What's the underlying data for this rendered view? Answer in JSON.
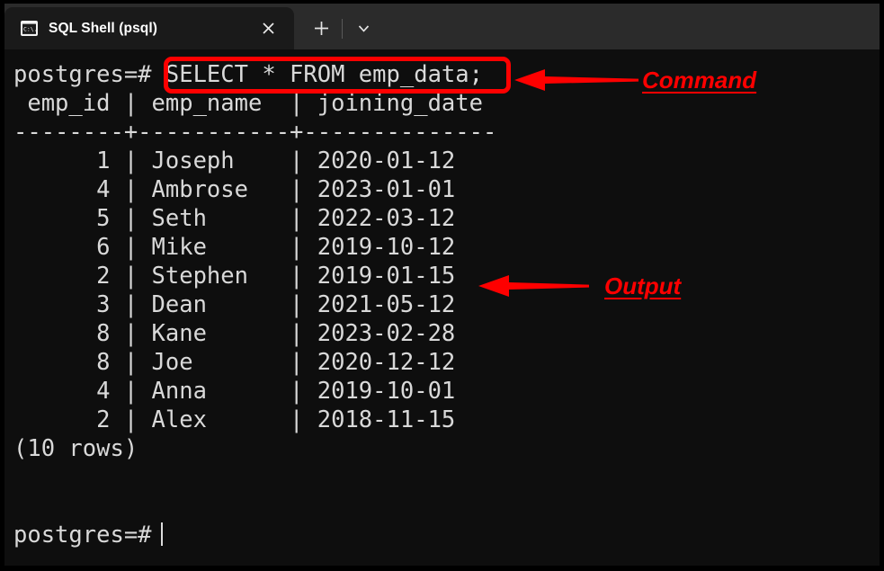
{
  "window": {
    "title": "SQL Shell (psql)",
    "background_color": "#0e0e0e",
    "tabstrip_color": "#2b2b2b",
    "text_color": "#d9d9d9",
    "accent_color": "#fe0000"
  },
  "tabstrip": {
    "tab_label": "SQL Shell (psql)",
    "icon_name": "console-icon",
    "close_label": "✕",
    "new_tab_label": "+",
    "dropdown_label": "⌄"
  },
  "terminal": {
    "prompt": "postgres=#",
    "command": "SELECT * FROM emp_data;",
    "command_line": "postgres=# SELECT * FROM emp_data;",
    "header_line": " emp_id | emp_name  | joining_date",
    "separator_line": "--------+-----------+--------------",
    "rows": [
      "      1 | Joseph    | 2020-01-12",
      "      4 | Ambrose   | 2023-01-01",
      "      5 | Seth      | 2022-03-12",
      "      6 | Mike      | 2019-10-12",
      "      2 | Stephen   | 2019-01-15",
      "      3 | Dean      | 2021-05-12",
      "      8 | Kane      | 2023-02-28",
      "      8 | Joe       | 2020-12-12",
      "      4 | Anna      | 2019-10-01",
      "      2 | Alex      | 2018-11-15"
    ],
    "row_count_line": "(10 rows)",
    "final_prompt": "postgres=#",
    "columns": [
      "emp_id",
      "emp_name",
      "joining_date"
    ],
    "table_data": [
      {
        "emp_id": "1",
        "emp_name": "Joseph",
        "joining_date": "2020-01-12"
      },
      {
        "emp_id": "4",
        "emp_name": "Ambrose",
        "joining_date": "2023-01-01"
      },
      {
        "emp_id": "5",
        "emp_name": "Seth",
        "joining_date": "2022-03-12"
      },
      {
        "emp_id": "6",
        "emp_name": "Mike",
        "joining_date": "2019-10-12"
      },
      {
        "emp_id": "2",
        "emp_name": "Stephen",
        "joining_date": "2019-01-15"
      },
      {
        "emp_id": "3",
        "emp_name": "Dean",
        "joining_date": "2021-05-12"
      },
      {
        "emp_id": "8",
        "emp_name": "Kane",
        "joining_date": "2023-02-28"
      },
      {
        "emp_id": "8",
        "emp_name": "Joe",
        "joining_date": "2020-12-12"
      },
      {
        "emp_id": "4",
        "emp_name": "Anna",
        "joining_date": "2019-10-01"
      },
      {
        "emp_id": "2",
        "emp_name": "Alex",
        "joining_date": "2018-11-15"
      }
    ]
  },
  "annotations": {
    "command_label": "Command",
    "output_label": "Output"
  }
}
